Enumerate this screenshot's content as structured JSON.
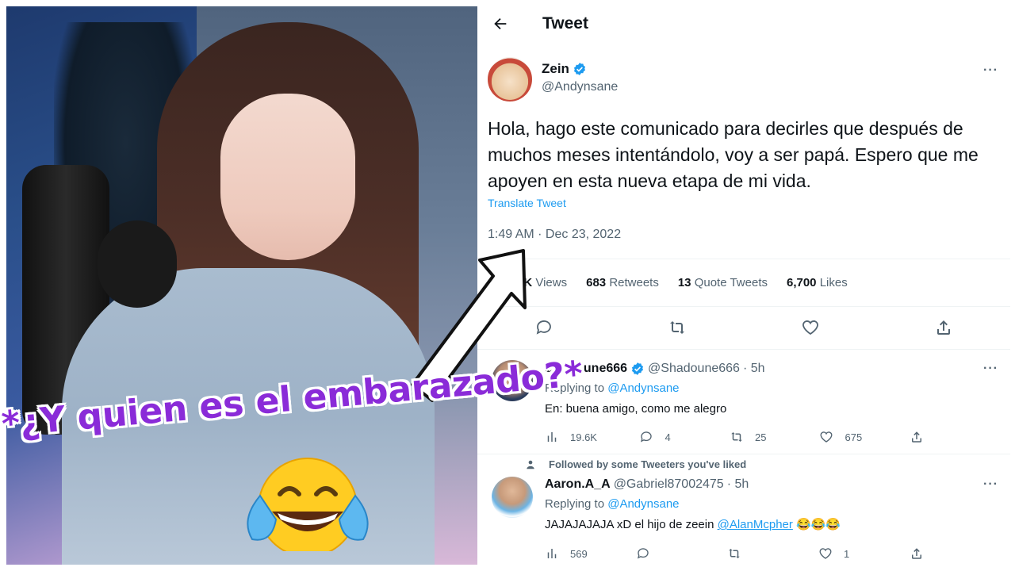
{
  "overlay": {
    "caption": "*¿Y quien es el embarazado?*"
  },
  "tweet_page": {
    "header_title": "Tweet",
    "author": {
      "name": "Zein",
      "handle": "@Andynsane"
    },
    "text": "Hola, hago este comunicado para decirles que después de muchos meses intentándolo, voy a ser papá. Espero que me apoyen en esta nueva etapa de mi vida.",
    "translate_label": "Translate Tweet",
    "timestamp": "1:49 AM · Dec 23, 2022",
    "stats": {
      "views_value": "8K",
      "views_label": "Views",
      "retweets_value": "683",
      "retweets_label": "Retweets",
      "quotes_value": "13",
      "quotes_label": "Quote Tweets",
      "likes_value": "6,700",
      "likes_label": "Likes"
    },
    "replies": [
      {
        "name": "Shadoune666",
        "handle": "@Shadoune666",
        "time": "· 5h",
        "replying_prefix": "Replying to",
        "replying_to": "@Andynsane",
        "text": "En: buena amigo, como me alegro",
        "views": "19.6K",
        "replies": "4",
        "retweets": "25",
        "likes": "675"
      },
      {
        "context": "Followed by some Tweeters you've liked",
        "name": "Aaron.A_A",
        "handle": "@Gabriel87002475",
        "time": "· 5h",
        "replying_prefix": "Replying to",
        "replying_to": "@Andynsane",
        "text_prefix": "JAJAJAJAJA xD el hijo de zeein",
        "mention": "@AlanMcpher",
        "text_suffix": "😂😂😂",
        "views": "569",
        "replies": "",
        "retweets": "",
        "likes": "1"
      }
    ]
  },
  "colors": {
    "accent": "#1d9bf0",
    "overlay_text": "#8a2bd8",
    "muted": "#536471"
  }
}
